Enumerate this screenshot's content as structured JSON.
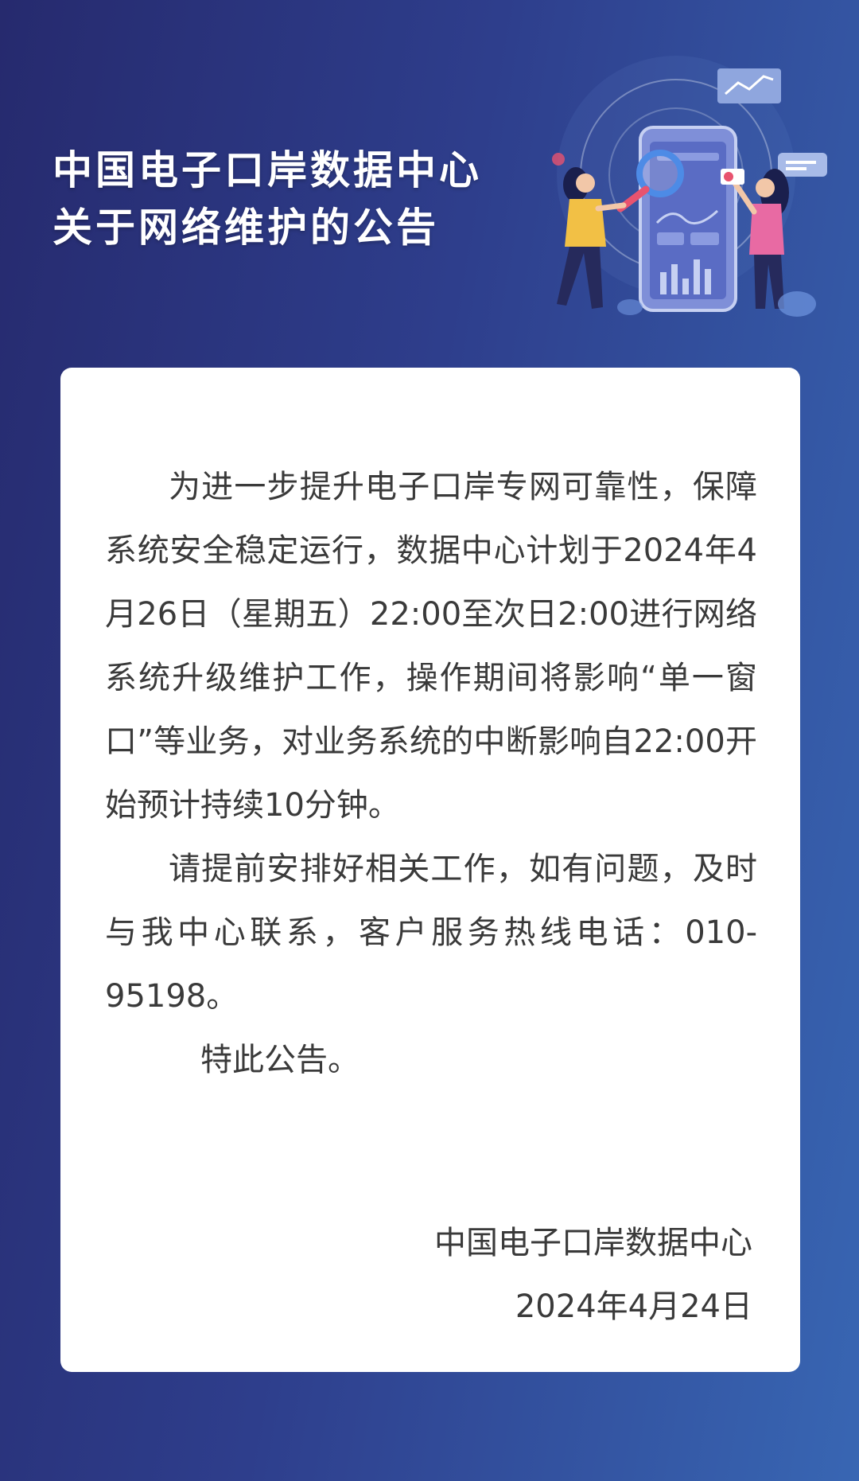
{
  "header": {
    "title_line1": "中国电子口岸数据中心",
    "title_line2": "关于网络维护的公告"
  },
  "illustration": {
    "icons": [
      "phone-dashboard-icon",
      "magnifier-icon",
      "chart-card-icon",
      "chat-bubble-icon",
      "person-icon"
    ]
  },
  "notice": {
    "paragraphs": [
      "为进一步提升电子口岸专网可靠性，保障系统安全稳定运行，数据中心计划于2024年4月26日（星期五）22:00至次日2:00进行网络系统升级维护工作，操作期间将影响“单一窗口”等业务，对业务系统的中断影响自22:00开始预计持续10分钟。",
      "请提前安排好相关工作，如有问题，及时与我中心联系，客户服务热线电话：010-95198。"
    ],
    "signoff": "特此公告。",
    "issuer": "中国电子口岸数据中心",
    "date": "2024年4月24日"
  },
  "colors": {
    "background_start": "#262a6e",
    "background_end": "#3866b3",
    "card": "#ffffff",
    "text": "#3a3a3a"
  }
}
